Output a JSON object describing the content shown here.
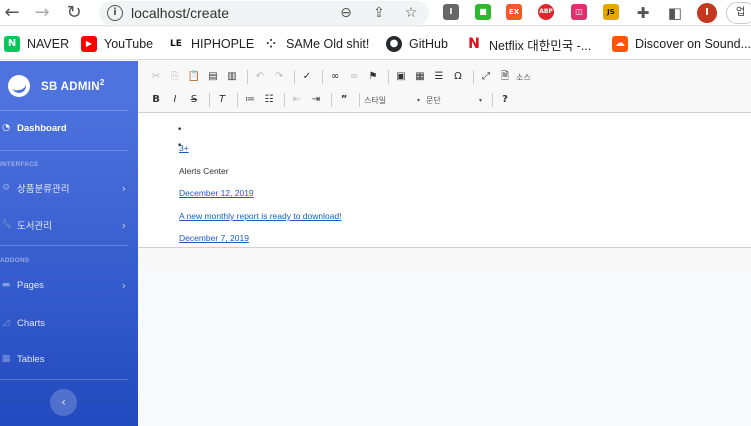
{
  "browser": {
    "url": "localhost/create",
    "bookmarks": [
      {
        "label": "NAVER",
        "icon": "naver-icon",
        "color": "#03c75a",
        "glyph": "N"
      },
      {
        "label": "YouTube",
        "icon": "youtube-icon",
        "color": "#ff0000",
        "glyph": "▶"
      },
      {
        "label": "HIPHOPLE",
        "icon": "hiphople-icon",
        "color": "#111111",
        "glyph": "LE"
      },
      {
        "label": "SAMe Old shit!",
        "icon": "same-icon",
        "color": "#333333",
        "glyph": "⁘"
      },
      {
        "label": "GitHub",
        "icon": "github-icon",
        "color": "#24292e",
        "glyph": "●"
      },
      {
        "label": "Netflix 대한민국 -...",
        "icon": "netflix-icon",
        "color": "#e50914",
        "glyph": "N"
      },
      {
        "label": "Discover on Sound...",
        "icon": "soundcloud-icon",
        "color": "#ff5500",
        "glyph": "☁"
      }
    ],
    "extensions": [
      {
        "icon": "extension-1-icon",
        "color": "#666666",
        "glyph": "I"
      },
      {
        "icon": "extension-2-icon",
        "color": "#2eb82e",
        "glyph": "■"
      },
      {
        "icon": "extension-3-icon",
        "color": "#f05a28",
        "glyph": "EX"
      },
      {
        "icon": "adblock-icon",
        "color": "#e0262c",
        "glyph": "ABP"
      },
      {
        "icon": "extension-5-icon",
        "color": "#e03070",
        "glyph": "◫"
      },
      {
        "icon": "js-extension-icon",
        "color": "#e6a700",
        "glyph": "JS"
      }
    ],
    "avatar_letter": "I",
    "avatar_color": "#c5371e",
    "right_tab_text": "업"
  },
  "sidebar": {
    "brand": "SB ADMIN",
    "brand_sup": "2",
    "dashboard": "Dashboard",
    "heading_interface": "INTERFACE",
    "item_category": "상품분류관리",
    "item_books": "도서관리",
    "heading_addons": "ADDONS",
    "item_pages": "Pages",
    "item_charts": "Charts",
    "item_tables": "Tables"
  },
  "editor": {
    "source_label": "소스",
    "style_label": "스타일",
    "format_label": "문단",
    "content": {
      "counter": "3+",
      "alerts_title": "Alerts Center",
      "date_1": "December 12, 2019",
      "message": "A new monthly report is ready to download!",
      "date_2": "December 7, 2019"
    }
  }
}
